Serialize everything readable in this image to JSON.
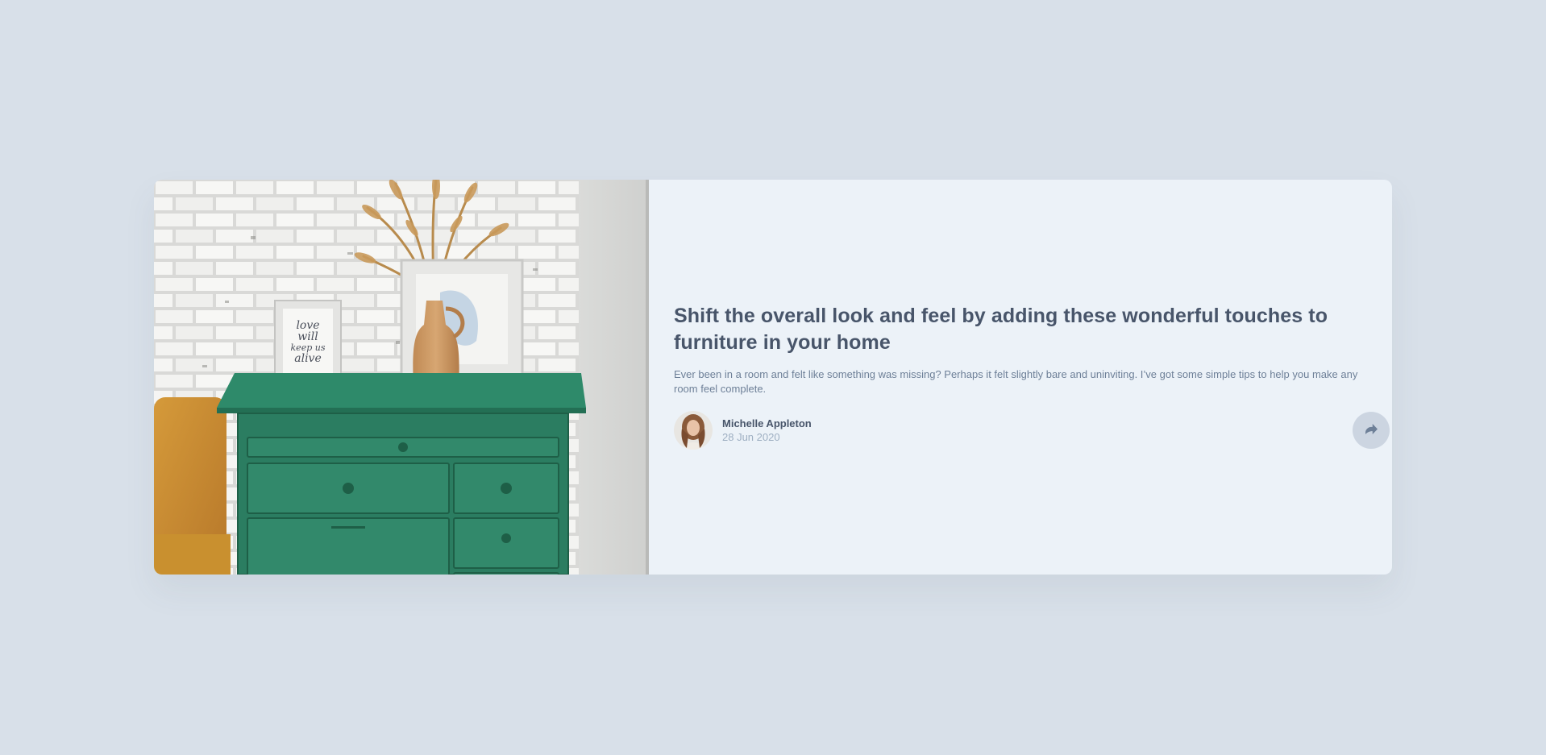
{
  "article": {
    "image": "drawers-photo",
    "title": "Shift the overall look and feel by adding these wonderful touches to furniture in your home",
    "description": "Ever been in a room and felt like something was missing? Perhaps it felt slightly bare and uninviting. I’ve got some simple tips to help you make any room feel complete."
  },
  "author": {
    "avatar": "avatar-michelle",
    "name": "Michelle Appleton",
    "date": "28 Jun 2020"
  },
  "share": {
    "icon": "share-icon"
  },
  "frame_text": [
    "love",
    "will",
    "keep us",
    "alive"
  ],
  "colors": {
    "background": "#d8e0e9",
    "card": "#ecf2f8",
    "title": "#48556a",
    "body": "#6e8098",
    "date": "#9eafc2",
    "share_bg": "#ccd5e1",
    "share_icon": "#6e8098"
  }
}
